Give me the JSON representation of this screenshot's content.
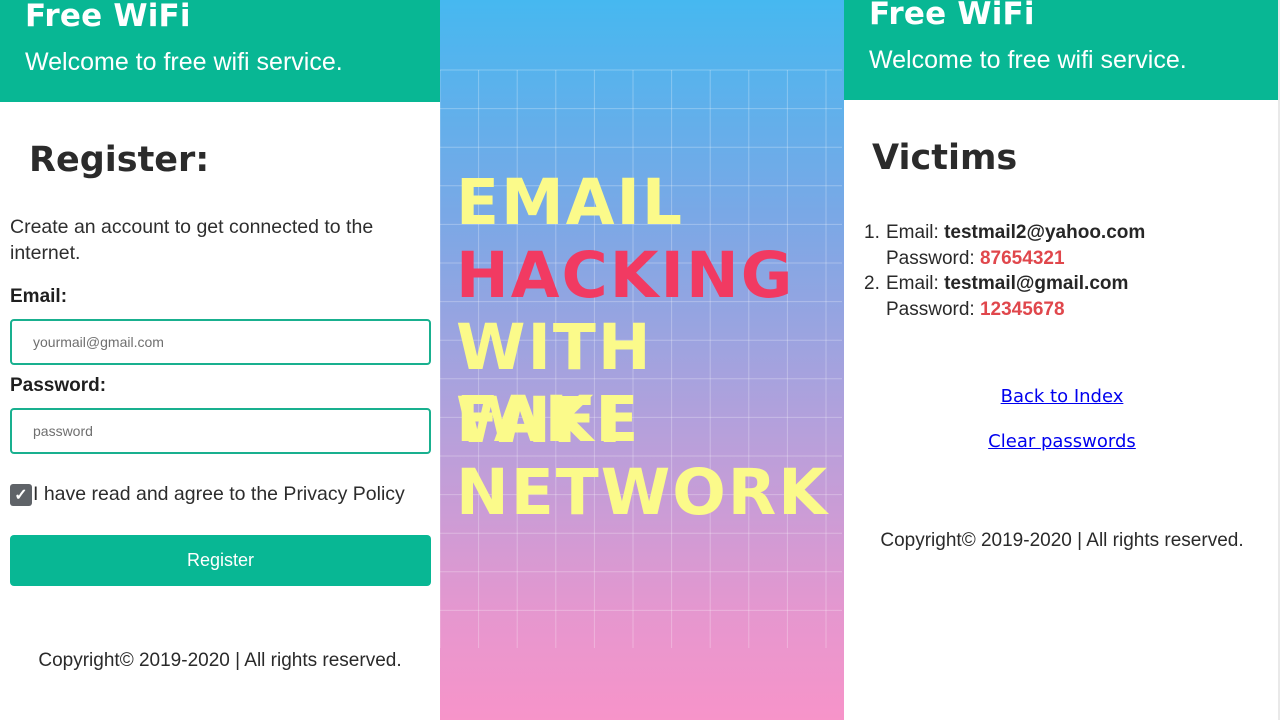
{
  "left": {
    "header": {
      "title": "Free WiFi",
      "subtitle": "Welcome to free wifi service."
    },
    "register_title": "Register:",
    "description": "Create an account to get connected to the internet.",
    "email_label": "Email:",
    "email_placeholder": "yourmail@gmail.com",
    "password_label": "Password:",
    "password_placeholder": "password",
    "agree_text": "I have read and agree to the Privacy Policy",
    "register_button": "Register",
    "copyright": "Copyright© 2019-2020 | All rights reserved."
  },
  "middle": {
    "lines": [
      "EMAIL",
      "HACKING",
      "WITH FAKE",
      "WIFI",
      "NETWORK"
    ],
    "colors": {
      "yellow": "#fbfa8a",
      "red": "#f13a62"
    }
  },
  "right": {
    "header": {
      "title": "Free WiFi",
      "subtitle": "Welcome to free wifi service."
    },
    "victims_title": "Victims",
    "email_prefix": "Email:",
    "password_prefix": "Password:",
    "victims": [
      {
        "num": "1.",
        "email": "testmail2@yahoo.com",
        "password": "87654321"
      },
      {
        "num": "2.",
        "email": "testmail@gmail.com",
        "password": "12345678"
      }
    ],
    "back_link": "Back to Index",
    "clear_link": "Clear passwords",
    "copyright": "Copyright© 2019-2020 | All rights reserved."
  },
  "colors": {
    "accent": "#08b794",
    "password_red": "#e0474c",
    "link_blue": "#0000ee"
  }
}
